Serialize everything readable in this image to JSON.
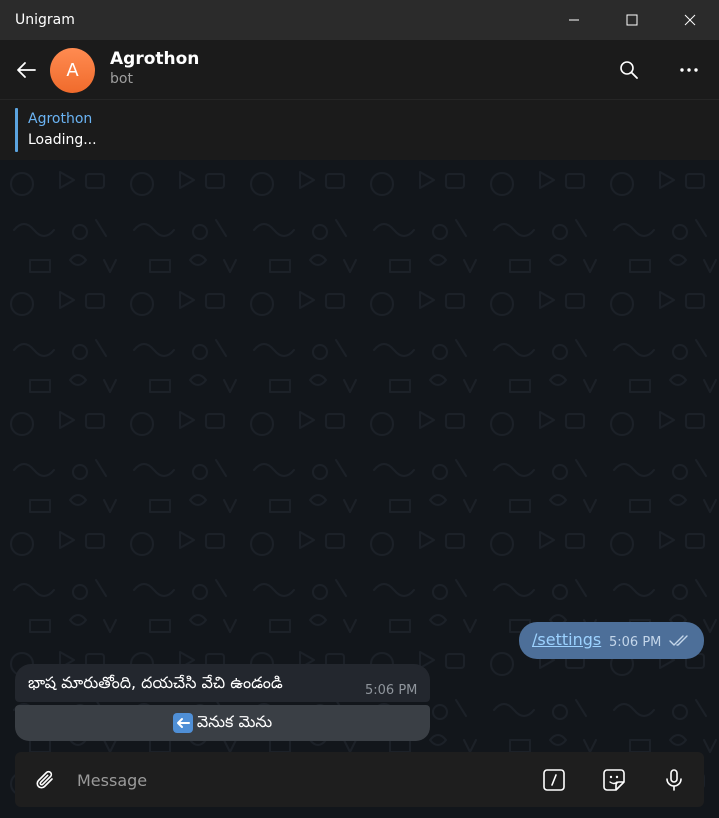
{
  "window": {
    "app_title": "Unigram",
    "controls": [
      "minimize",
      "maximize",
      "close"
    ]
  },
  "header": {
    "avatar_letter": "A",
    "chat_name": "Agrothon",
    "status": "bot",
    "icons": [
      "back-arrow-icon",
      "search-icon",
      "more-icon"
    ]
  },
  "pinned": {
    "title": "Agrothon",
    "text": "Loading..."
  },
  "messages": {
    "outgoing": {
      "text": "/settings",
      "time": "5:06 PM",
      "status": "read"
    },
    "incoming": {
      "text": "భాష మారుతోంది, దయచేసి వేచి ఉండండి",
      "time": "5:06 PM"
    },
    "keyboard_button": {
      "label": "వెనుక మెను",
      "icon": "back-arrow-emoji"
    }
  },
  "composer": {
    "placeholder": "Message",
    "icons": [
      "attach-icon",
      "commands-icon",
      "sticker-icon",
      "mic-icon"
    ]
  },
  "colors": {
    "accent": "#6ab3f3",
    "outgoing_bubble": "#4d6f99",
    "incoming_bubble": "#23272e",
    "avatar": "#f5793a"
  }
}
